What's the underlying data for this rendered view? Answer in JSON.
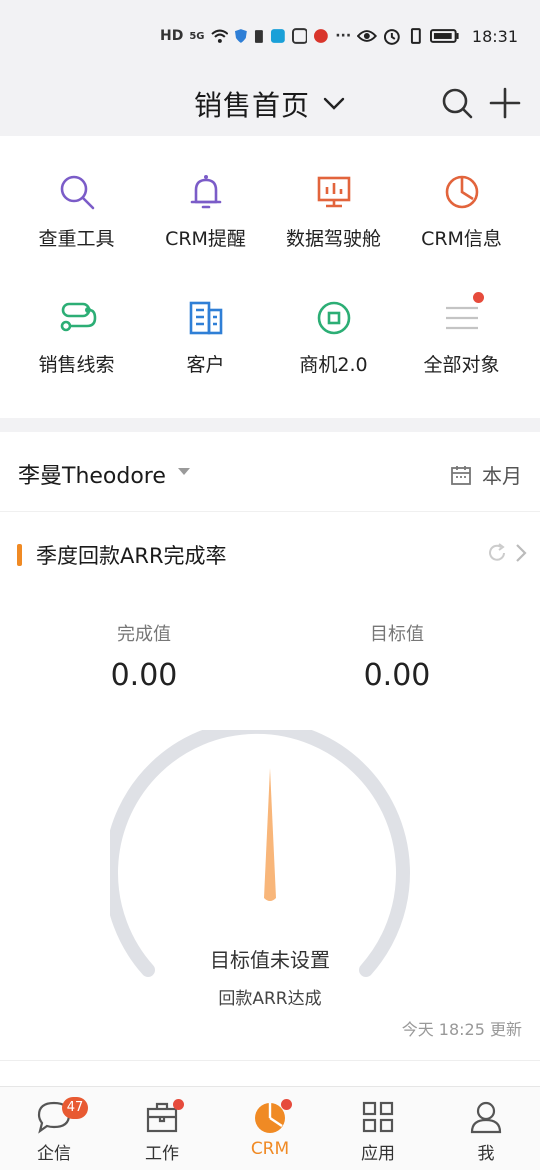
{
  "status_bar": {
    "network": "HD",
    "signal": "5G",
    "time": "18:31",
    "icons": [
      "hd-icon",
      "signal-icon",
      "wifi-icon",
      "shield-icon",
      "battery-small-icon",
      "app-icon",
      "app-icon",
      "app-icon",
      "more-icon",
      "eye-icon",
      "alarm-icon",
      "vibrate-icon",
      "battery-icon"
    ]
  },
  "header": {
    "title": "销售首页"
  },
  "quick_actions": [
    {
      "label": "查重工具",
      "icon": "search-icon",
      "color": "#7b5cc8"
    },
    {
      "label": "CRM提醒",
      "icon": "bell-icon",
      "color": "#7b5cc8"
    },
    {
      "label": "数据驾驶舱",
      "icon": "dashboard-icon",
      "color": "#e2643c"
    },
    {
      "label": "CRM信息",
      "icon": "clock-icon",
      "color": "#e2643c"
    },
    {
      "label": "销售线索",
      "icon": "route-icon",
      "color": "#2cae75"
    },
    {
      "label": "客户",
      "icon": "building-icon",
      "color": "#2f7fd6"
    },
    {
      "label": "商机2.0",
      "icon": "coin-icon",
      "color": "#2cae75"
    },
    {
      "label": "全部对象",
      "icon": "menu-icon",
      "color": "#bbbbbb"
    }
  ],
  "owner": {
    "name": "李曼Theodore",
    "period": "本月"
  },
  "card": {
    "title": "季度回款ARR完成率",
    "completed_label": "完成值",
    "completed_value": "0.00",
    "target_label": "目标值",
    "target_value": "0.00",
    "gauge_status": "目标值未设置",
    "gauge_caption": "回款ARR达成",
    "updated": "今天 18:25 更新",
    "gauge_progress": 0
  },
  "tabbar": {
    "items": [
      {
        "label": "企信",
        "icon": "chat-icon",
        "badge": "47"
      },
      {
        "label": "工作",
        "icon": "briefcase-icon"
      },
      {
        "label": "CRM",
        "icon": "pie-chart-icon"
      },
      {
        "label": "应用",
        "icon": "grid-icon"
      },
      {
        "label": "我",
        "icon": "user-icon"
      }
    ],
    "active": "CRM"
  },
  "colors": {
    "accent": "#f08a24",
    "badge": "#e85a32",
    "gauge_track": "#dfe1e6",
    "needle": "#f8b67a"
  }
}
